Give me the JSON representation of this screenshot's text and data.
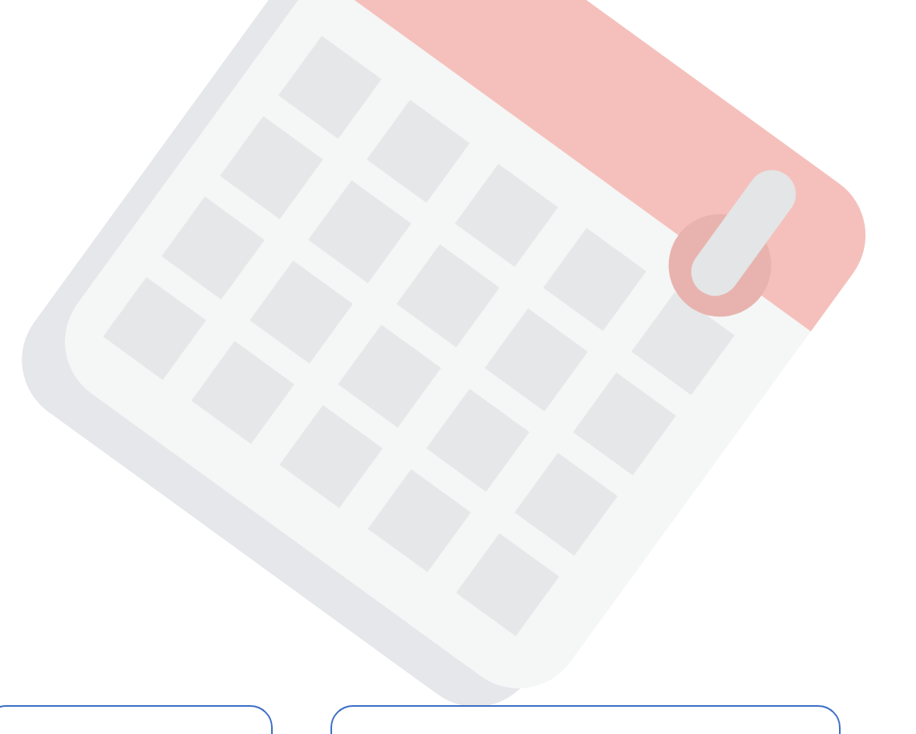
{
  "buttons": [
    {
      "kind": "outlined"
    },
    {
      "kind": "outlined"
    }
  ]
}
